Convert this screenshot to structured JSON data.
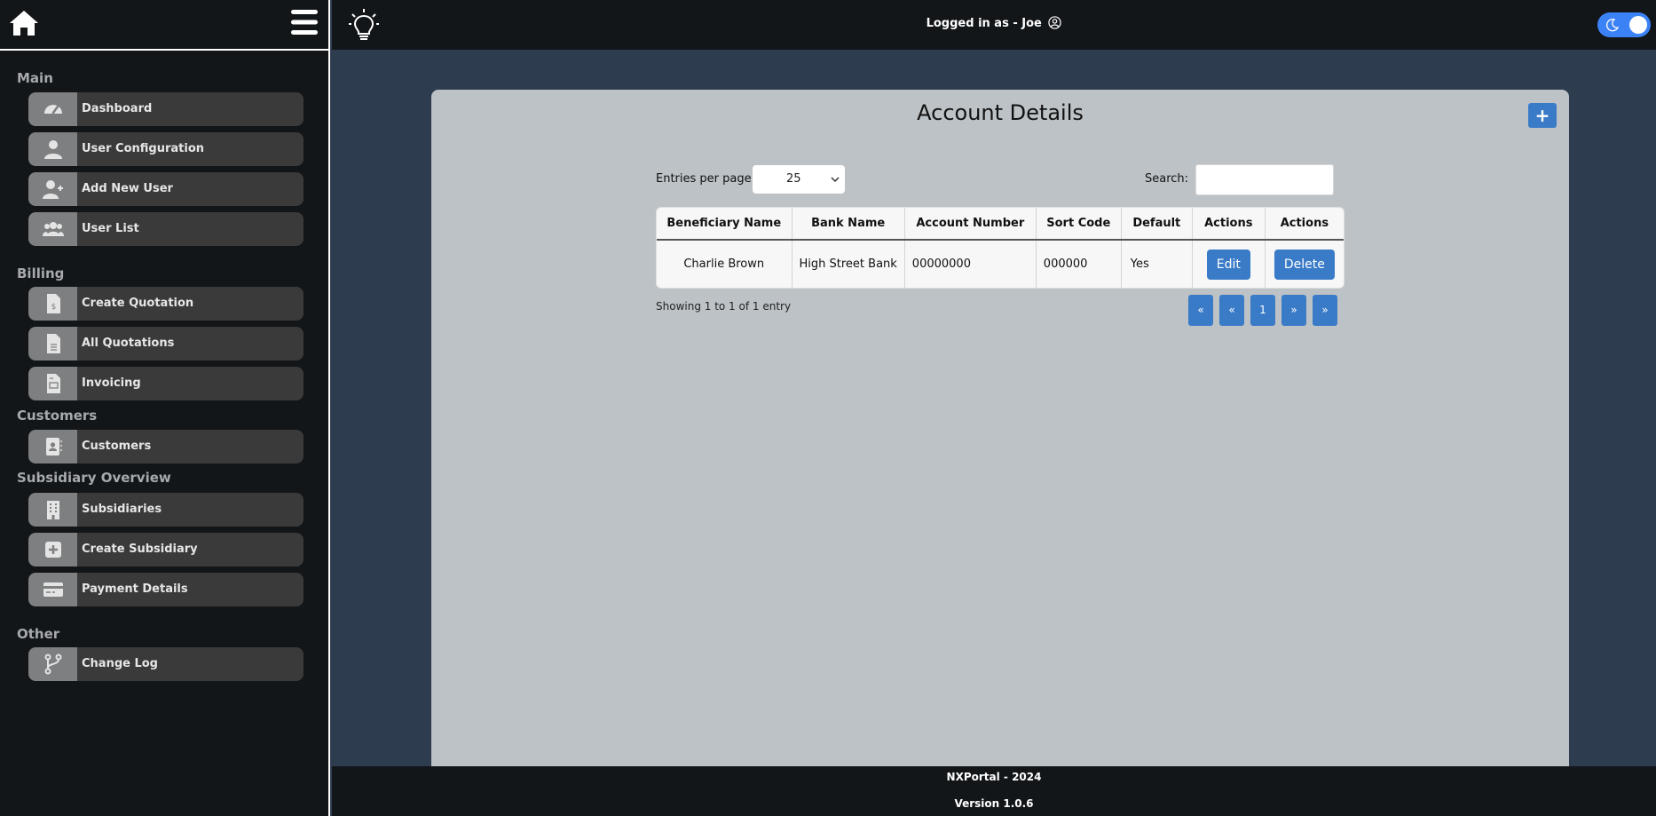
{
  "sidebar": {
    "sections": {
      "main": "Main",
      "billing": "Billing",
      "customers": "Customers",
      "subsidiary": "Subsidiary Overview",
      "other": "Other"
    },
    "items": {
      "dashboard": "Dashboard",
      "user_configuration": "User Configuration",
      "add_new_user": "Add New User",
      "user_list": "User List",
      "create_quotation": "Create Quotation",
      "all_quotations": "All Quotations",
      "invoicing": "Invoicing",
      "customers": "Customers",
      "subsidiaries": "Subsidiaries",
      "create_subsidiary": "Create Subsidiary",
      "payment_details": "Payment Details",
      "change_log": "Change Log"
    }
  },
  "topbar": {
    "logged_in": "Logged in as - Joe"
  },
  "main": {
    "title": "Account Details",
    "add_label": "+",
    "entries_label": "Entries per page",
    "entries_value": "25",
    "search_label": "Search:",
    "search_value": "",
    "table": {
      "headers": [
        "Beneficiary Name",
        "Bank Name",
        "Account Number",
        "Sort Code",
        "Default",
        "Actions",
        "Actions"
      ],
      "rows": [
        {
          "beneficiary": "Charlie Brown",
          "bank": "High Street Bank",
          "account_number": "00000000",
          "sort_code": "000000",
          "default": "Yes",
          "edit": "Edit",
          "delete": "Delete"
        }
      ]
    },
    "showing": "Showing 1 to 1 of 1 entry",
    "pagination": [
      "«",
      "«",
      "1",
      "»",
      "»"
    ]
  },
  "footer": {
    "line1": "NXPortal - 2024",
    "line2": "Version 1.0.6"
  },
  "colors": {
    "accent": "#3a7bc8",
    "toggle": "#3b82f6",
    "sidebar_bg": "#121619",
    "page_bg": "#2e3c50",
    "card_bg": "#bdc2c6"
  }
}
